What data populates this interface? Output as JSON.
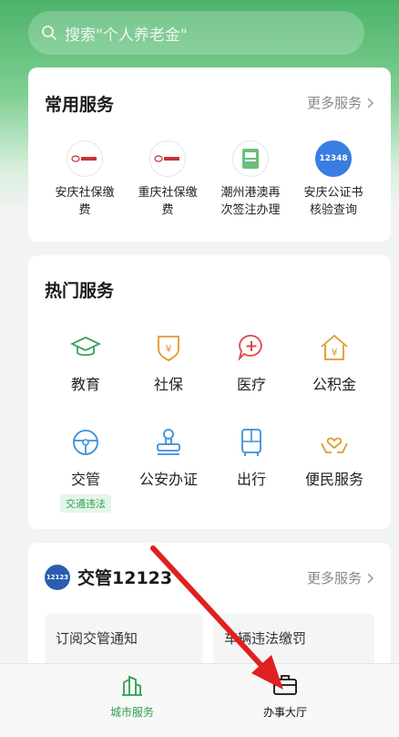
{
  "search": {
    "placeholder": "搜索\"个人养老金\""
  },
  "common": {
    "title": "常用服务",
    "more": "更多服务",
    "items": [
      {
        "line1": "安庆社保缴",
        "line2": "费",
        "icon": "social-security-logo"
      },
      {
        "line1": "重庆社保缴",
        "line2": "费",
        "icon": "social-security-logo"
      },
      {
        "line1": "潮州港澳再",
        "line2": "次签注办理",
        "icon": "passport-icon"
      },
      {
        "line1": "安庆公证书",
        "line2": "核验查询",
        "icon": "notary-12348-icon"
      }
    ]
  },
  "hot": {
    "title": "热门服务",
    "items": [
      {
        "label": "教育",
        "icon": "graduation-cap-icon"
      },
      {
        "label": "社保",
        "icon": "shield-yen-icon"
      },
      {
        "label": "医疗",
        "icon": "medical-cross-icon"
      },
      {
        "label": "公积金",
        "icon": "house-yen-icon"
      },
      {
        "label": "交管",
        "icon": "steering-wheel-icon",
        "tag": "交通违法"
      },
      {
        "label": "公安办证",
        "icon": "seal-stamp-icon"
      },
      {
        "label": "出行",
        "icon": "bus-icon"
      },
      {
        "label": "便民服务",
        "icon": "heart-hands-icon"
      }
    ]
  },
  "traffic": {
    "logo": "12123",
    "title": "交管12123",
    "more": "更多服务",
    "sub1": "订阅交管通知",
    "sub2": "车辆违法缴罚"
  },
  "tabs": {
    "city": "城市服务",
    "hall": "办事大厅"
  },
  "colors": {
    "accent": "#2e9e55",
    "arrow": "#e02020"
  }
}
